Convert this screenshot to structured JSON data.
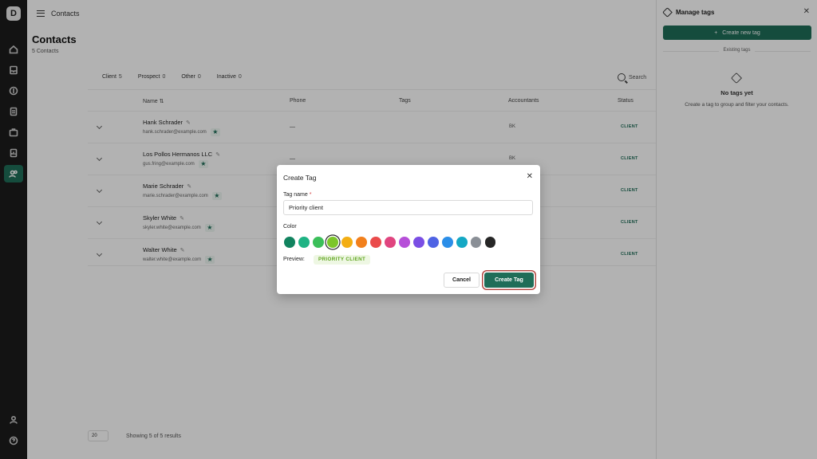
{
  "app": {
    "logo_text": "D"
  },
  "topbar": {
    "breadcrumb": "Contacts"
  },
  "page": {
    "title": "Contacts",
    "subtitle": "5 Contacts"
  },
  "filters": [
    {
      "label": "Client",
      "count": "5"
    },
    {
      "label": "Prospect",
      "count": "0"
    },
    {
      "label": "Other",
      "count": "0"
    },
    {
      "label": "Inactive",
      "count": "0"
    }
  ],
  "search": {
    "label": "Search"
  },
  "table": {
    "columns": {
      "name": "Name ⇅",
      "phone": "Phone",
      "tags": "Tags",
      "accountants": "Accountants",
      "status": "Status"
    },
    "rows": [
      {
        "name": "Hank Schrader",
        "email": "hank.schrader@example.com",
        "phone": "—",
        "accountants": "BK",
        "status": "CLIENT"
      },
      {
        "name": "Los Pollos Hermanos LLC",
        "email": "gus.fring@example.com",
        "phone": "—",
        "accountants": "BK",
        "status": "CLIENT"
      },
      {
        "name": "Marie Schrader",
        "email": "marie.schrader@example.com",
        "phone": "",
        "accountants": "",
        "status": "CLIENT"
      },
      {
        "name": "Skyler White",
        "email": "skyler.white@example.com",
        "phone": "",
        "accountants": "",
        "status": "CLIENT"
      },
      {
        "name": "Walter White",
        "email": "walter.white@example.com",
        "phone": "",
        "accountants": "",
        "status": "CLIENT"
      }
    ]
  },
  "footer": {
    "page_size": "20",
    "results": "Showing 5 of 5 results"
  },
  "panel": {
    "title": "Manage tags",
    "create_button": "Create new tag",
    "existing_label": "Existing tags",
    "empty_title": "No tags yet",
    "empty_subtitle": "Create a tag to group and filter your contacts."
  },
  "modal": {
    "title": "Create Tag",
    "name_label": "Tag name",
    "name_value": "Priority client",
    "color_label": "Color",
    "colors": [
      "#12835f",
      "#1fb384",
      "#3bbf5a",
      "#7cc62a",
      "#f3ae14",
      "#f2801c",
      "#ea4b4b",
      "#e0457f",
      "#b64fd8",
      "#7a4ee4",
      "#4f63e4",
      "#2b8ee8",
      "#14a8c4",
      "#8a8f96",
      "#262626"
    ],
    "selected_color": "#7cc62a",
    "preview_label": "Preview:",
    "preview_text": "PRIORITY CLIENT",
    "preview_fg": "#5fa51e",
    "preview_bg": "#eef7e3",
    "cancel_label": "Cancel",
    "create_label": "Create Tag"
  }
}
